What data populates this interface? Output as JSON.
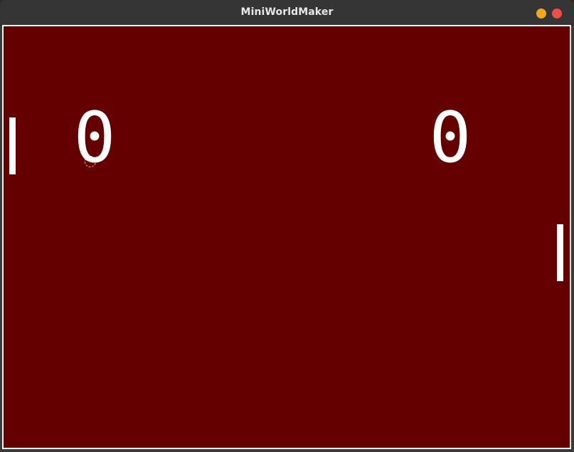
{
  "window": {
    "title": "MiniWorldMaker"
  },
  "game": {
    "scores": {
      "left": "0",
      "right": "0"
    },
    "colors": {
      "field": "#640000",
      "foreground": "#ffffff",
      "minimize_button": "#f0a81c",
      "close_button": "#ec4f4a"
    }
  }
}
